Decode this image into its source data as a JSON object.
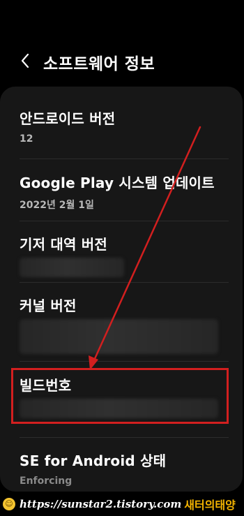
{
  "header": {
    "title": "소프트웨어 정보",
    "back_icon": "chevron-left-icon"
  },
  "items": [
    {
      "title": "안드로이드 버전",
      "value": "12"
    },
    {
      "title": "Google Play 시스템 업데이트",
      "value": "2022년 2월 1일"
    },
    {
      "title": "기저 대역 버전",
      "value": ""
    },
    {
      "title": "커널 버전",
      "value": ""
    },
    {
      "title": "빌드번호",
      "value": ""
    },
    {
      "title": "SE for Android 상태",
      "value": "Enforcing"
    }
  ],
  "annotation": {
    "highlight_color": "#d21f1f",
    "arrow_color": "#d21f1f"
  },
  "footer": {
    "emoji": "😊",
    "url": "https://sunstar2.tistory.com",
    "brand": "새터의태양"
  }
}
